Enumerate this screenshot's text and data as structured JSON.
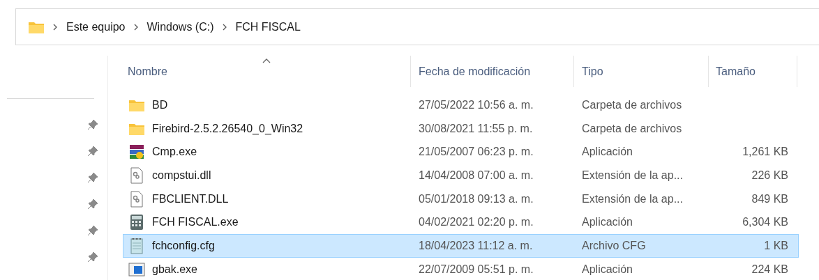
{
  "breadcrumb": [
    "Este equipo",
    "Windows (C:)",
    "FCH FISCAL"
  ],
  "columns": [
    {
      "label": "Nombre",
      "sorted": true
    },
    {
      "label": "Fecha de modificación",
      "sorted": false
    },
    {
      "label": "Tipo",
      "sorted": false
    },
    {
      "label": "Tamaño",
      "sorted": false
    }
  ],
  "rows": [
    {
      "kind": "folder",
      "name": "BD",
      "modified": "27/05/2022 10:56 a. m.",
      "type": "Carpeta de archivos",
      "size": "",
      "selected": false
    },
    {
      "kind": "folder",
      "name": "Firebird-2.5.2.26540_0_Win32",
      "modified": "30/08/2021 11:55 p. m.",
      "type": "Carpeta de archivos",
      "size": "",
      "selected": false
    },
    {
      "kind": "archive",
      "name": "Cmp.exe",
      "modified": "21/05/2007 06:23 p. m.",
      "type": "Aplicación",
      "size": "1,261 KB",
      "selected": false
    },
    {
      "kind": "library",
      "name": "compstui.dll",
      "modified": "14/04/2008 07:00 a. m.",
      "type": "Extensión de la ap...",
      "size": "226 KB",
      "selected": false
    },
    {
      "kind": "library",
      "name": "FBCLIENT.DLL",
      "modified": "05/01/2018 09:13 a. m.",
      "type": "Extensión de la ap...",
      "size": "849 KB",
      "selected": false
    },
    {
      "kind": "calculator",
      "name": "FCH FISCAL.exe",
      "modified": "04/02/2021 02:20 p. m.",
      "type": "Aplicación",
      "size": "6,304 KB",
      "selected": false
    },
    {
      "kind": "config",
      "name": "fchconfig.cfg",
      "modified": "18/04/2023 11:12 a. m.",
      "type": "Archivo CFG",
      "size": "1 KB",
      "selected": true
    },
    {
      "kind": "program",
      "name": "gbak.exe",
      "modified": "22/07/2009 05:51 p. m.",
      "type": "Aplicación",
      "size": "224 KB",
      "selected": false
    }
  ]
}
